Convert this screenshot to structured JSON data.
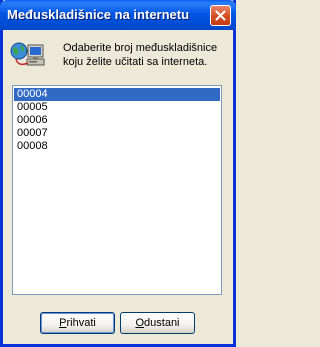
{
  "window": {
    "title": "Međuskladišnice na internetu"
  },
  "message": {
    "line1": "Odaberite broj međuskladišnice",
    "line2": "koju želite učitati sa interneta."
  },
  "list": {
    "items": [
      "00004",
      "00005",
      "00006",
      "00007",
      "00008"
    ],
    "selected": "00004"
  },
  "buttons": {
    "ok": {
      "accel": "P",
      "rest": "rihvati"
    },
    "cancel": {
      "accel": "O",
      "rest": "dustani"
    }
  },
  "colors": {
    "titlebar": "#0256e6",
    "selection": "#316ac5",
    "close": "#d44d22"
  },
  "icons": {
    "info": "computer-network-icon",
    "close": "close-icon"
  }
}
